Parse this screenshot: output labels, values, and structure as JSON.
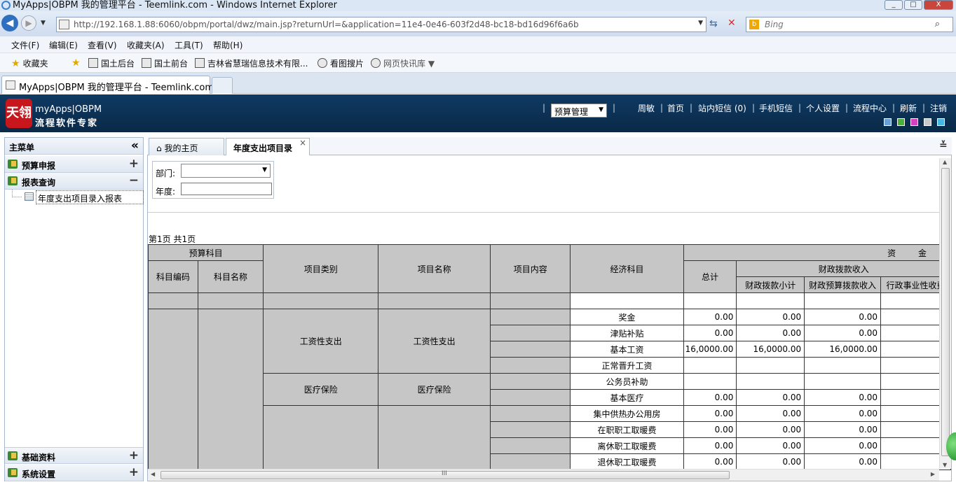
{
  "browser": {
    "window_title": "MyApps|OBPM 我的管理平台 - Teemlink.com - Windows Internet Explorer",
    "url": "http://192.168.1.88:6060/obpm/portal/dwz/main.jsp?returnUrl=&application=11e4-0e46-603f2d48-bc18-bd16d96f6a6b",
    "search_placeholder": "Bing",
    "menu": [
      "文件(F)",
      "编辑(E)",
      "查看(V)",
      "收藏夹(A)",
      "工具(T)",
      "帮助(H)"
    ],
    "favorites_label": "收藏夹",
    "favorites": [
      "国土后台",
      "国土前台",
      "吉林省慧瑞信息技术有限...",
      "看图搜片",
      "网页快讯库"
    ],
    "tab_title": "MyApps|OBPM 我的管理平台 - Teemlink.com",
    "window_buttons": [
      "_",
      "□",
      "X"
    ]
  },
  "header": {
    "logo_text": "天翎",
    "brand_line1": "myApps|OBPM",
    "brand_line2": "流程软件专家",
    "module_select": "预算管理",
    "links": [
      "周敏",
      "首页",
      "站内短信 (0)",
      "手机短信",
      "个人设置",
      "流程中心",
      "刷新",
      "注销"
    ],
    "theme_colors": [
      "#6aa0d8",
      "#4caf3a",
      "#d63fc0",
      "#c9c9c9",
      "#48b4e0"
    ]
  },
  "sidebar": {
    "title": "主菜单",
    "collapse_icon": "«",
    "sections": [
      {
        "label": "预算申报",
        "toggle": "+"
      },
      {
        "label": "报表查询",
        "toggle": "−"
      },
      {
        "label": "基础资料",
        "toggle": "+"
      },
      {
        "label": "系统设置",
        "toggle": "+"
      }
    ],
    "subitem": "年度支出项目录入报表"
  },
  "tabs": [
    {
      "label": "我的主页",
      "icon": "⌂"
    },
    {
      "label": "年度支出项目录",
      "close": "×"
    }
  ],
  "filter": {
    "dept_label": "部门:",
    "dept_value": "",
    "year_label": "年度:",
    "year_value": ""
  },
  "page_info": "第1页  共1页",
  "table": {
    "headers": {
      "budget_subject": "预算科目",
      "subject_code": "科目编码",
      "subject_name": "科目名称",
      "project_category": "项目类别",
      "project_name": "项目名称",
      "project_content": "项目内容",
      "economic_subject": "经济科目",
      "funds": "资 金",
      "total": "总计",
      "fiscal_income": "财政拨款收入",
      "fiscal_subtotal": "财政拨款小计",
      "fiscal_budget": "财政预算拨款收入",
      "admin_fee": "行政事业性收费"
    },
    "groups": [
      {
        "category": "工资性支出",
        "name": "工资性支出"
      },
      {
        "category": "医疗保险",
        "name": "医疗保险"
      },
      {
        "category": "",
        "name": ""
      }
    ],
    "rows": [
      {
        "econ": "奖金",
        "total": "0.00",
        "subtotal": "0.00",
        "budget": "0.00"
      },
      {
        "econ": "津贴补贴",
        "total": "0.00",
        "subtotal": "0.00",
        "budget": "0.00"
      },
      {
        "econ": "基本工资",
        "total": "16,0000.00",
        "subtotal": "16,0000.00",
        "budget": "16,0000.00"
      },
      {
        "econ": "正常晋升工资",
        "total": "",
        "subtotal": "",
        "budget": ""
      },
      {
        "econ": "公务员补助",
        "total": "",
        "subtotal": "",
        "budget": ""
      },
      {
        "econ": "基本医疗",
        "total": "0.00",
        "subtotal": "0.00",
        "budget": "0.00"
      },
      {
        "econ": "集中供热办公用房",
        "total": "0.00",
        "subtotal": "0.00",
        "budget": "0.00"
      },
      {
        "econ": "在职职工取暖费",
        "total": "0.00",
        "subtotal": "0.00",
        "budget": "0.00"
      },
      {
        "econ": "离休职工取暖费",
        "total": "0.00",
        "subtotal": "0.00",
        "budget": "0.00"
      },
      {
        "econ": "退休职工取暖费",
        "total": "0.00",
        "subtotal": "0.00",
        "budget": "0.00"
      }
    ]
  },
  "hscroll_grip": "III"
}
